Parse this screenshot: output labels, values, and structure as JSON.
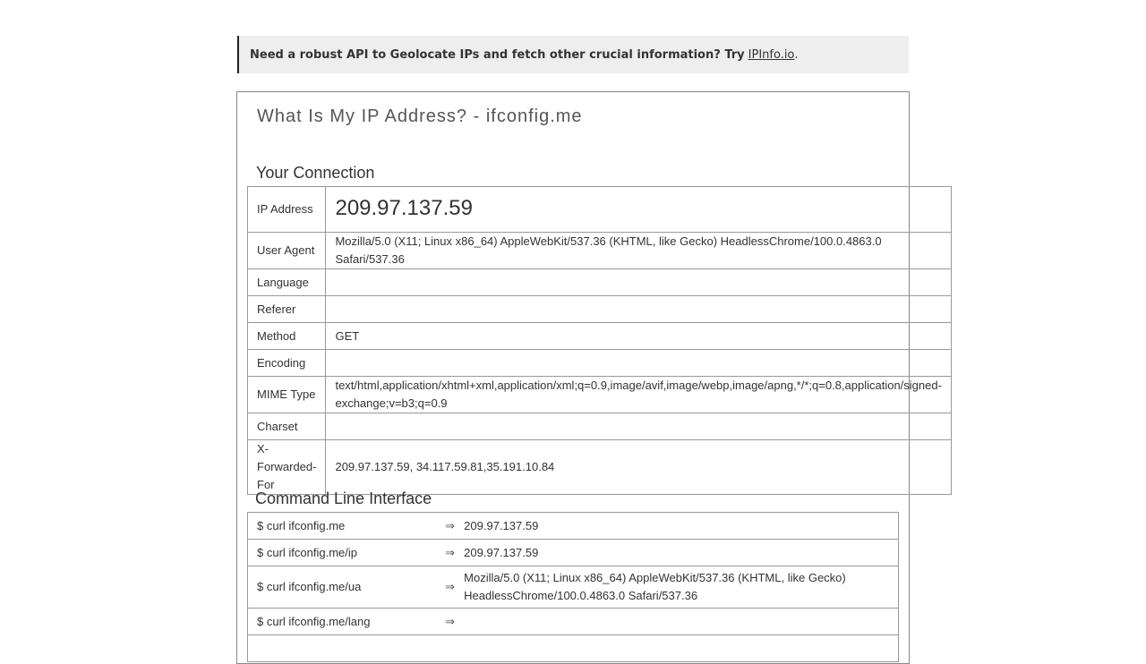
{
  "banner": {
    "text": "Need a robust API to Geolocate IPs and fetch other crucial information? Try",
    "link": "IPInfo.io",
    "tail": "."
  },
  "title": "What Is My IP Address? - ifconfig.me",
  "connection": {
    "heading": "Your Connection",
    "rows": [
      {
        "label": "IP Address",
        "value": "209.97.137.59"
      },
      {
        "label": "User Agent",
        "value": "Mozilla/5.0 (X11; Linux x86_64) AppleWebKit/537.36 (KHTML, like Gecko) HeadlessChrome/100.0.4863.0 Safari/537.36"
      },
      {
        "label": "Language",
        "value": ""
      },
      {
        "label": "Referer",
        "value": ""
      },
      {
        "label": "Method",
        "value": "GET"
      },
      {
        "label": "Encoding",
        "value": ""
      },
      {
        "label": "MIME Type",
        "value_line1": "text/html,application/xhtml+xml,application/xml;q=0.9,image/avif,image/webp,image/apng,*/*;q=0.8,application/signed-",
        "value_line2": "exchange;v=b3;q=0.9"
      },
      {
        "label": "Charset",
        "value": ""
      },
      {
        "label": "X-Forwarded-For",
        "value": "209.97.137.59, 34.117.59.81,35.191.10.84"
      }
    ]
  },
  "cli": {
    "heading": "Command Line Interface",
    "arrow": "⇒",
    "rows": [
      {
        "cmd": "$ curl ifconfig.me",
        "out": "209.97.137.59"
      },
      {
        "cmd": "$ curl ifconfig.me/ip",
        "out": "209.97.137.59"
      },
      {
        "cmd": "$ curl ifconfig.me/ua",
        "out": "Mozilla/5.0 (X11; Linux x86_64) AppleWebKit/537.36 (KHTML, like Gecko) HeadlessChrome/100.0.4863.0 Safari/537.36"
      },
      {
        "cmd": "$ curl ifconfig.me/lang",
        "out": ""
      }
    ]
  }
}
